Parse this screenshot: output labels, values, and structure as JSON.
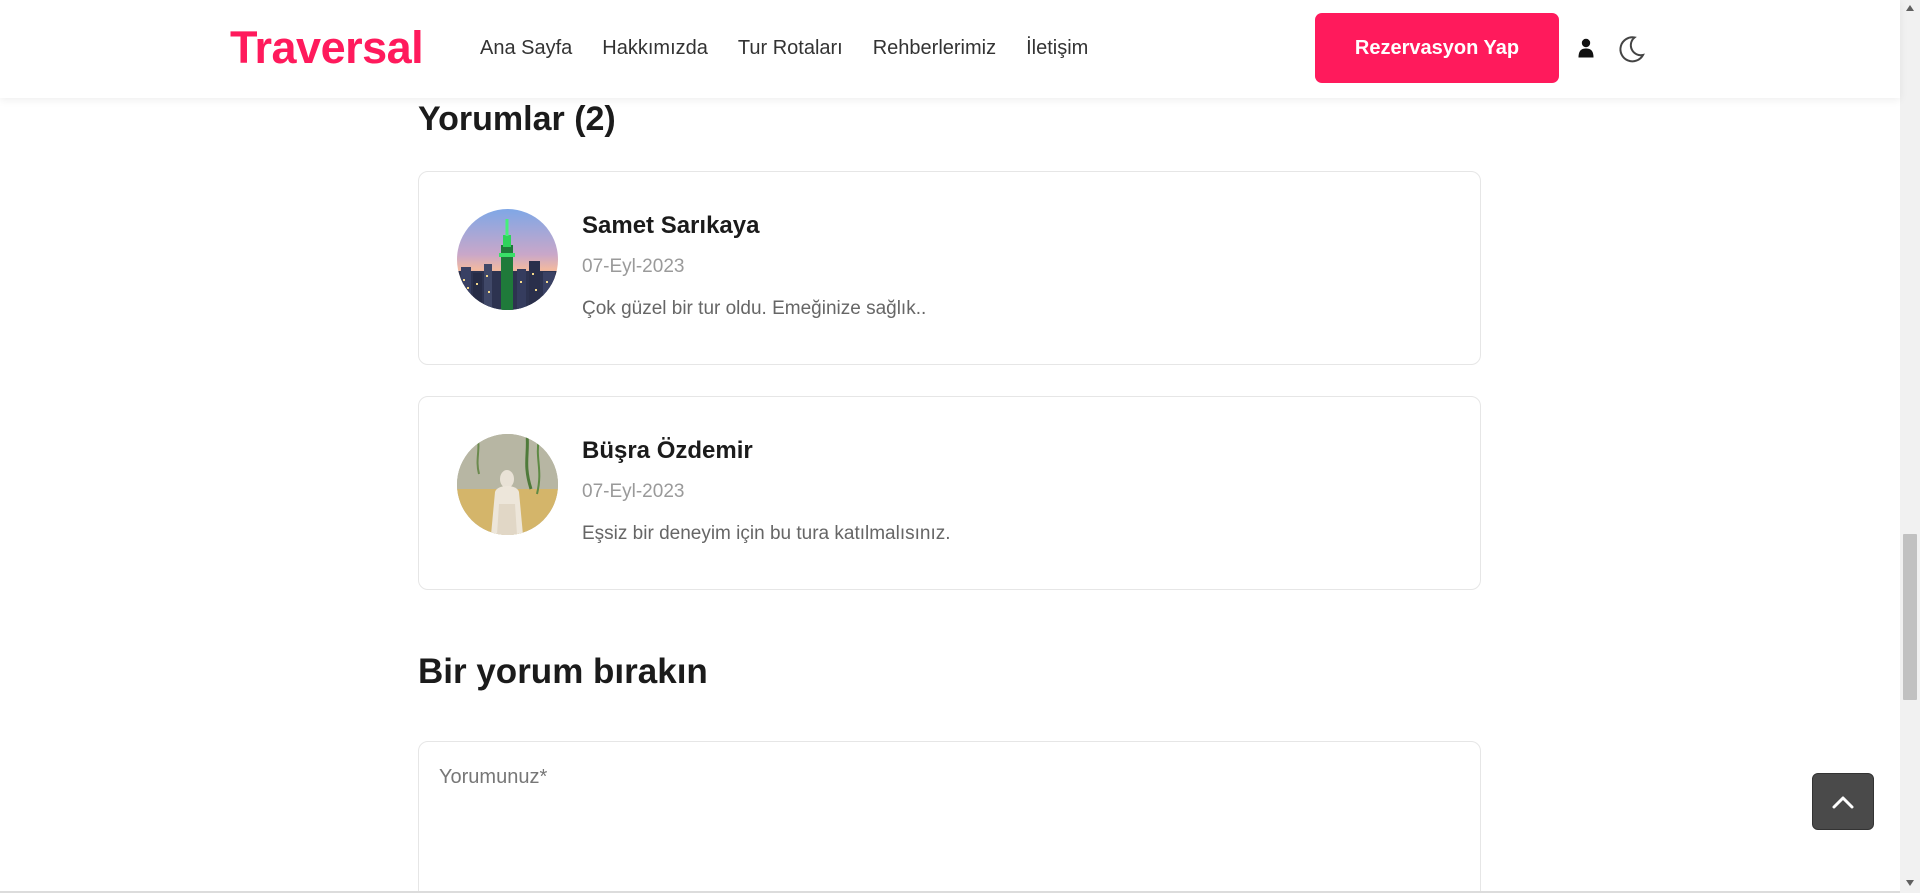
{
  "header": {
    "logo": "Traversal",
    "nav": [
      {
        "label": "Ana Sayfa"
      },
      {
        "label": "Hakkımızda"
      },
      {
        "label": "Tur Rotaları"
      },
      {
        "label": "Rehberlerimiz"
      },
      {
        "label": "İletişim"
      }
    ],
    "reserve_label": "Rezervasyon Yap",
    "icons": [
      "user-icon",
      "moon-icon"
    ]
  },
  "comments": {
    "title": "Yorumlar (2)",
    "items": [
      {
        "name": "Samet Sarıkaya",
        "date": "07-Eyl-2023",
        "text": "Çok güzel bir tur oldu. Emeğinize sağlık..",
        "avatar": "city-skyline-photo"
      },
      {
        "name": "Büşra Özdemir",
        "date": "07-Eyl-2023",
        "text": "Eşsiz bir deneyim için bu tura katılmalısınız.",
        "avatar": "person-photo"
      }
    ]
  },
  "form": {
    "title": "Bir yorum bırakın",
    "comment_placeholder": "Yorumunuz*"
  },
  "colors": {
    "brand": "#ff1a5c",
    "to_top_bg": "#4a4a4a"
  },
  "to_top_icon": "chevron-up-icon"
}
